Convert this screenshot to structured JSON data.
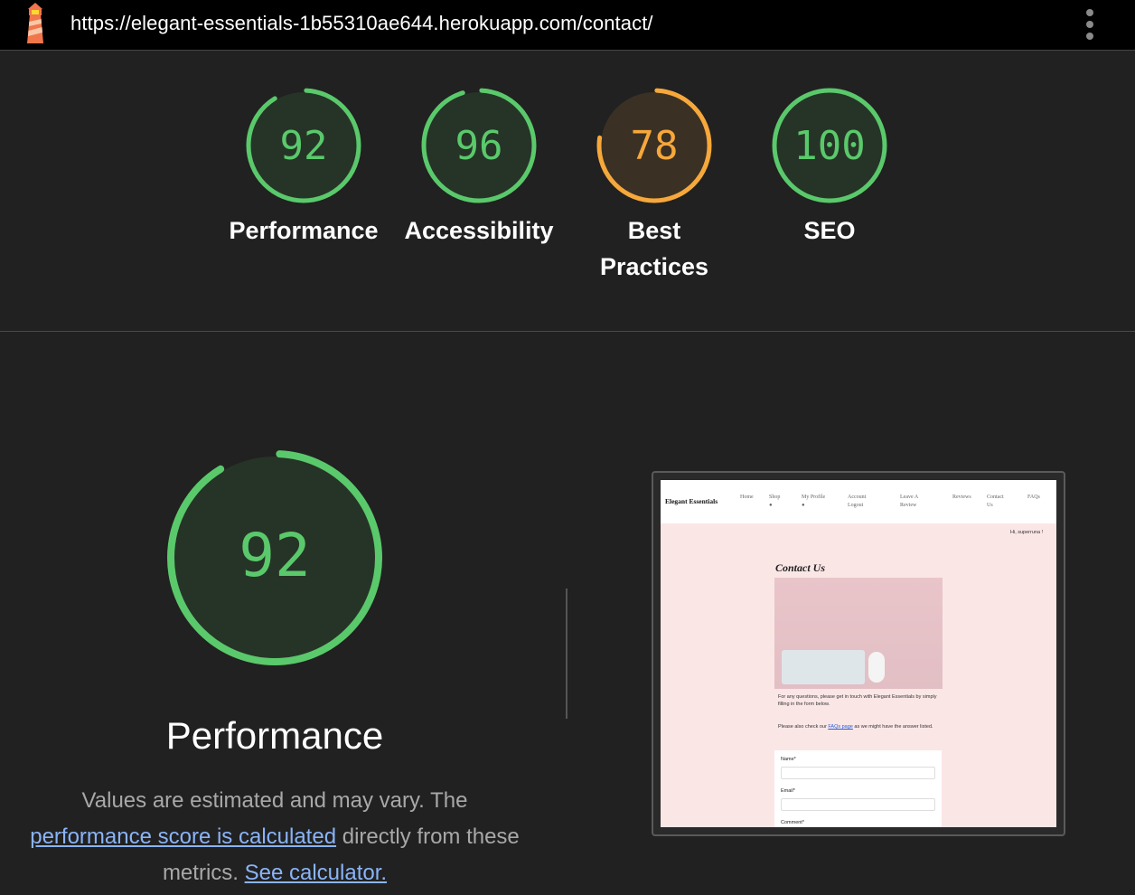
{
  "browser": {
    "url": "https://elegant-essentials-1b55310ae644.herokuapp.com/contact/",
    "logo_icon": "lighthouse-icon",
    "menu_icon": "kebab-menu-icon"
  },
  "colors": {
    "pass": "#5ac96b",
    "average": "#f6a83b",
    "background": "#212121",
    "link": "#8ab4f8"
  },
  "scores": [
    {
      "value": "92",
      "label": "Performance",
      "fraction": 0.92,
      "status": "pass"
    },
    {
      "value": "96",
      "label": "Accessibility",
      "fraction": 0.96,
      "status": "pass"
    },
    {
      "value": "78",
      "label_line1": "Best",
      "label_line2": "Practices",
      "fraction": 0.78,
      "status": "average"
    },
    {
      "value": "100",
      "label": "SEO",
      "fraction": 1.0,
      "status": "pass"
    }
  ],
  "performance": {
    "score": "92",
    "fraction": 0.92,
    "title": "Performance",
    "desc_part1": "Values are estimated and may vary. The ",
    "desc_link1": "performance score is calculated",
    "desc_part2": " directly from these metrics. ",
    "desc_link2": "See calculator."
  },
  "screenshot": {
    "brand": "Elegant Essentials",
    "nav": [
      "Home",
      "Shop",
      "My Profile",
      "Account",
      "Logout",
      "Leave A",
      "Review",
      "Reviews",
      "Contact",
      "Us",
      "FAQs"
    ],
    "greeting": "Hi, superruna !",
    "title": "Contact Us",
    "para1": "For any questions, please get in touch with Elegant Essentials by simply filling in the form below.",
    "para2_before": "Please also check our ",
    "para2_link": "FAQs page",
    "para2_after": " as we might have the answer listed.",
    "form_labels": [
      "Name*",
      "Email*",
      "Comment*"
    ]
  }
}
